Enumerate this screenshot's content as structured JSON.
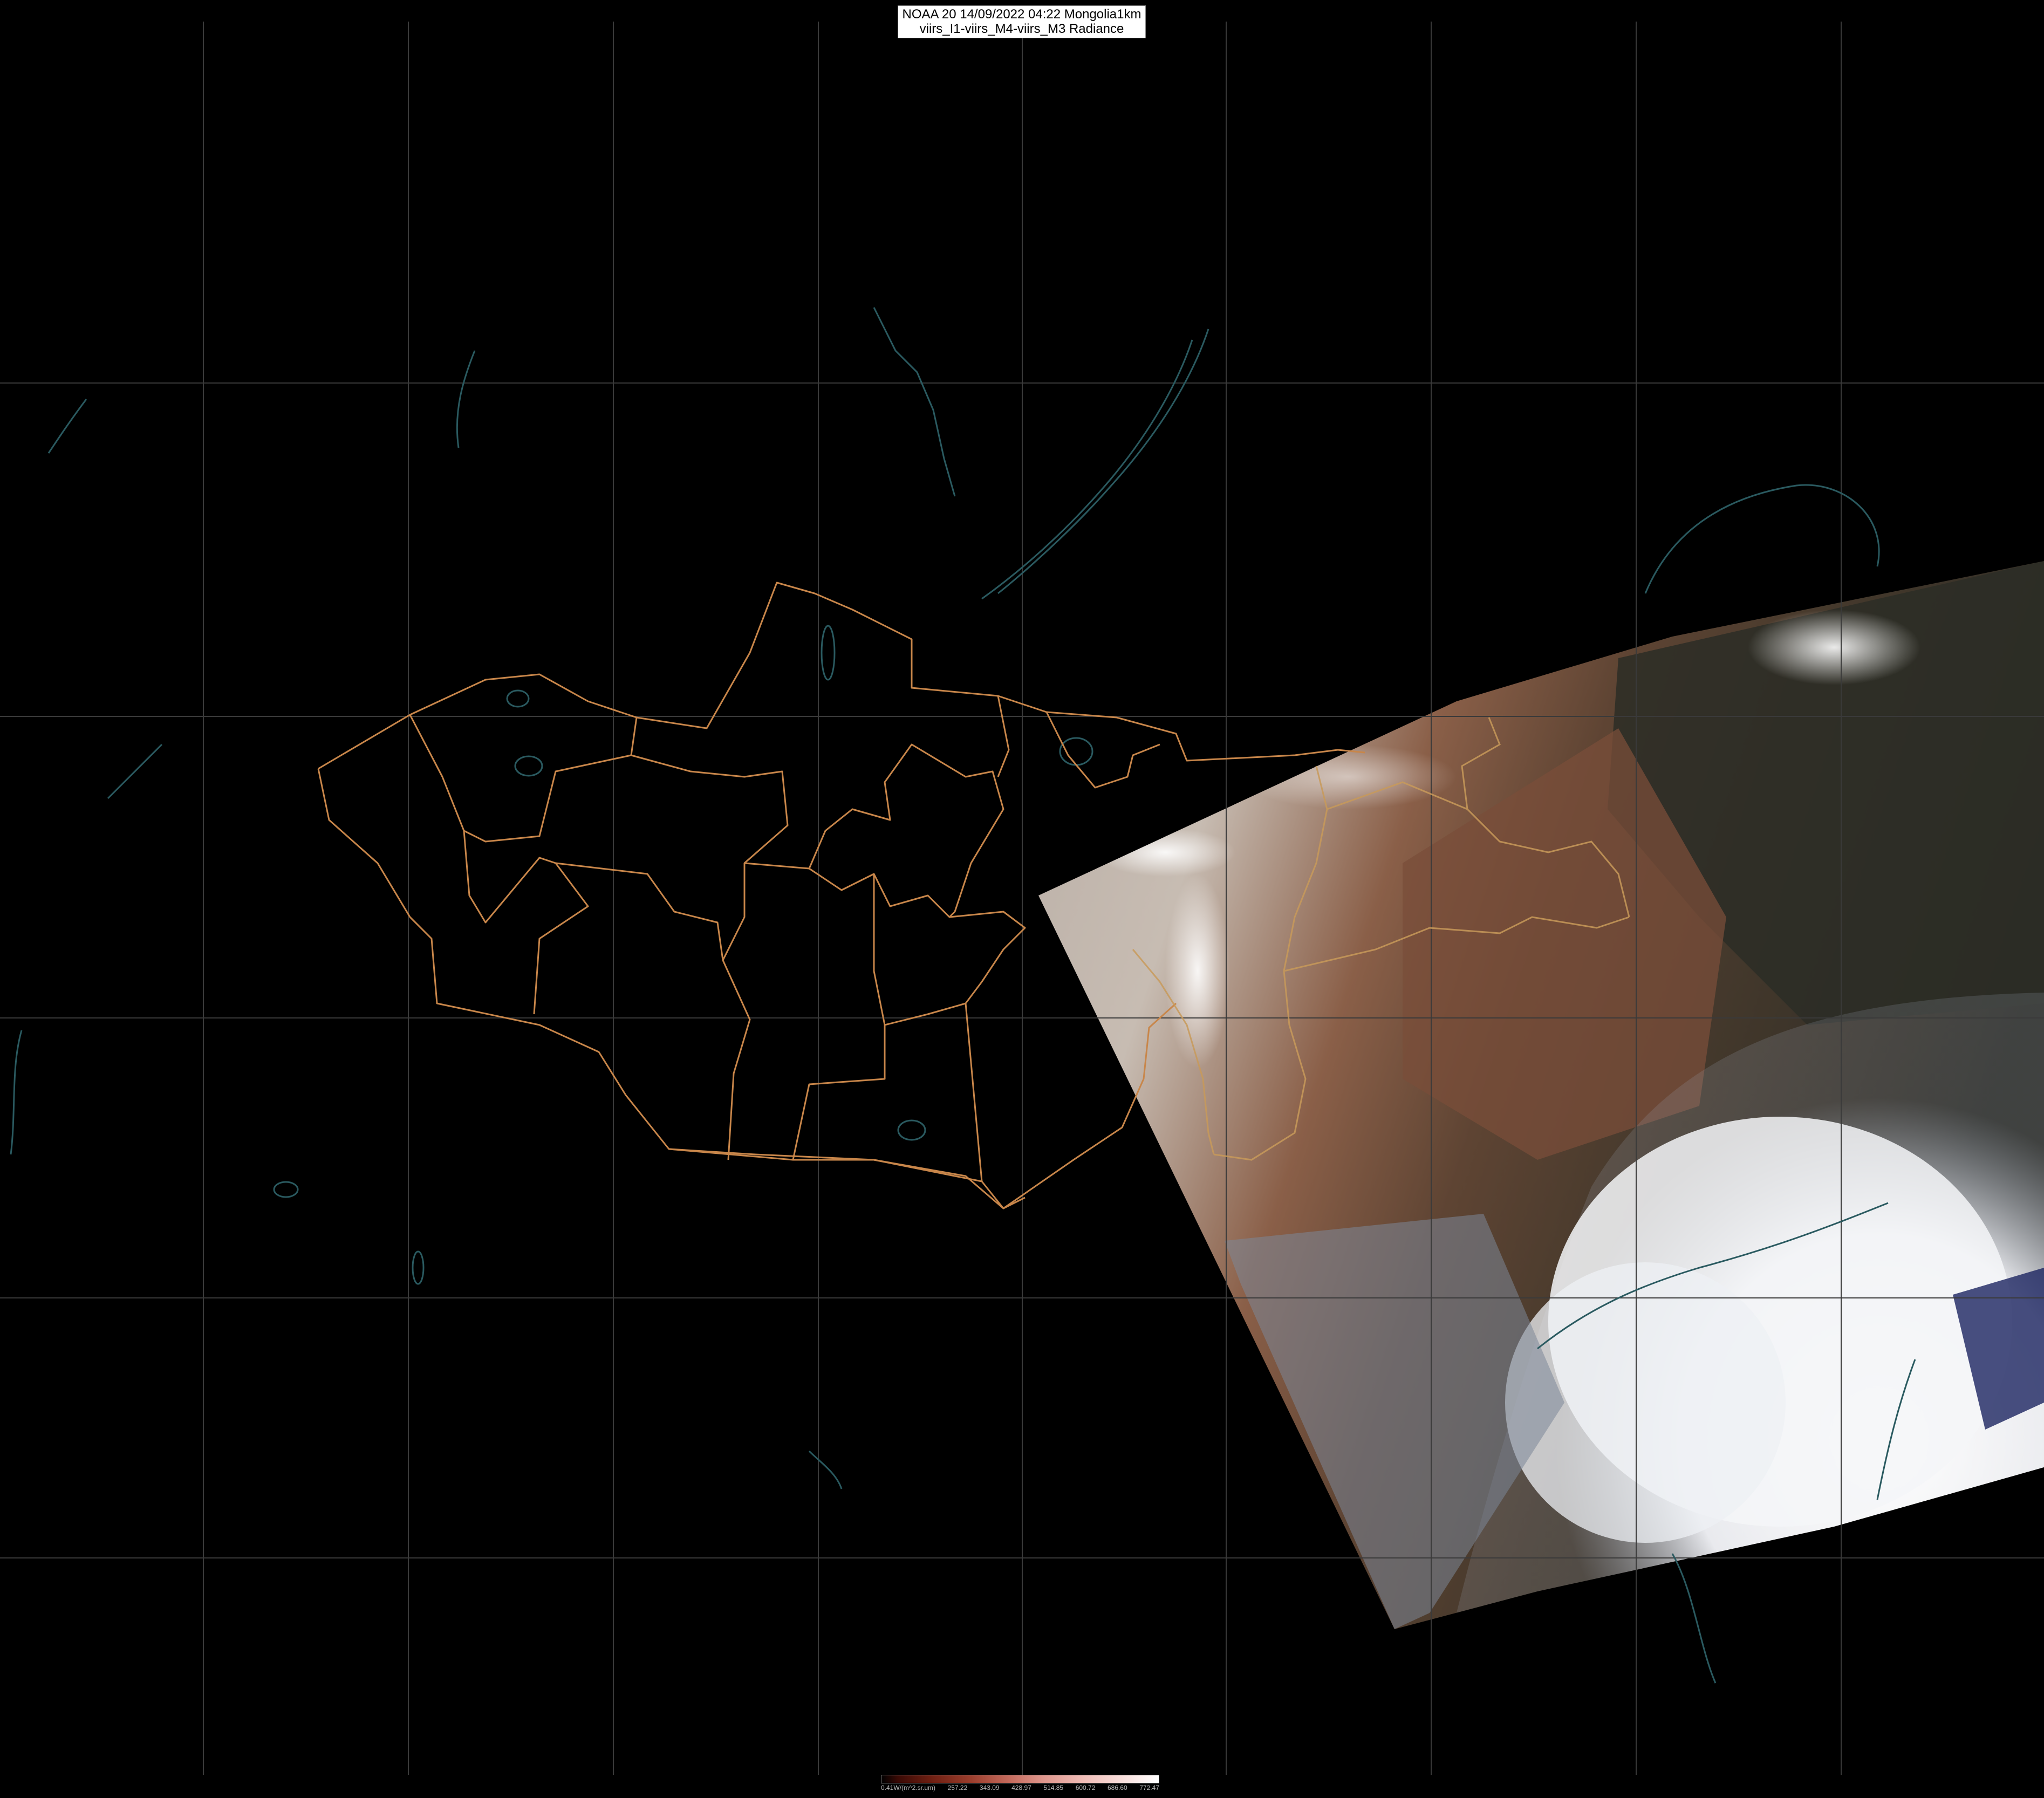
{
  "header": {
    "line1": "NOAA 20 14/09/2022 04:22 Mongolia1km",
    "line2": "viirs_I1-viirs_M4-viirs_M3 Radiance"
  },
  "legend": {
    "ticks": [
      "0.41W/(m^2.sr.um)",
      "257.22",
      "343.09",
      "428.97",
      "514.85",
      "600.72",
      "686.60",
      "772.47"
    ]
  },
  "colors": {
    "background": "#000000",
    "graticule": "#3a3a3a",
    "borders": "#c8864a",
    "coastlines": "#2a5a60",
    "cloud": "#f2f2f4",
    "desert": "#b8a79a",
    "land_brown": "#6b4a38"
  }
}
